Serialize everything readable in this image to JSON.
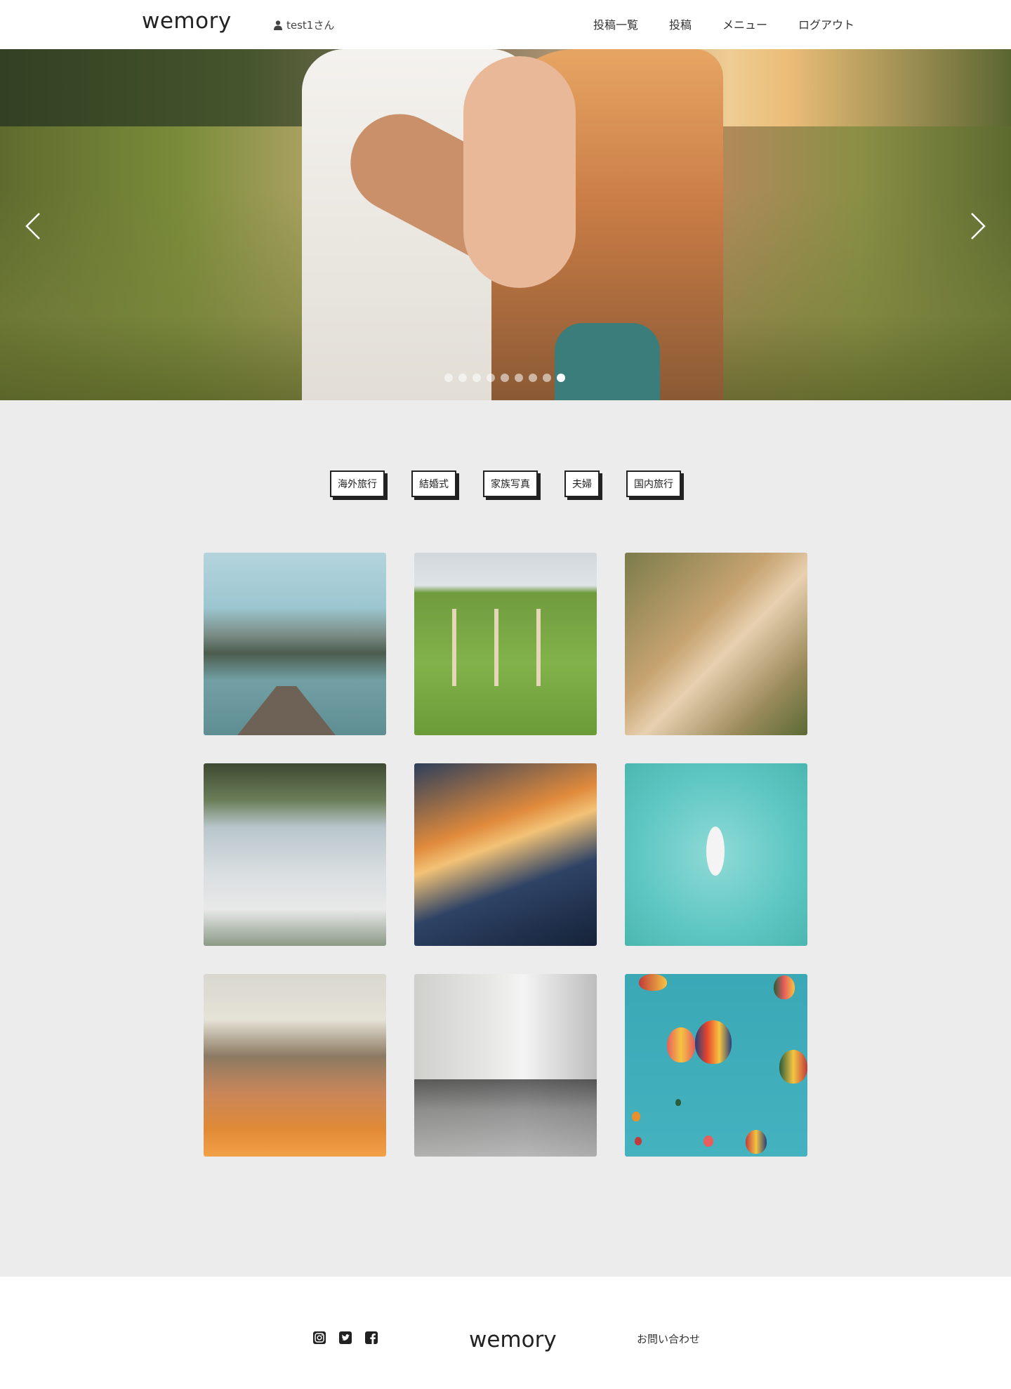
{
  "header": {
    "logo": "wemory",
    "user": "test1さん",
    "nav": [
      "投稿一覧",
      "投稿",
      "メニュー",
      "ログアウト"
    ]
  },
  "hero": {
    "slide_count": 9,
    "active_slide": 9
  },
  "tags": [
    "海外旅行",
    "結婚式",
    "家族写真",
    "夫婦",
    "国内旅行"
  ],
  "footer": {
    "logo": "wemory",
    "contact": "お問い合わせ",
    "social_icons": [
      "instagram-icon",
      "twitter-icon",
      "facebook-icon"
    ]
  }
}
